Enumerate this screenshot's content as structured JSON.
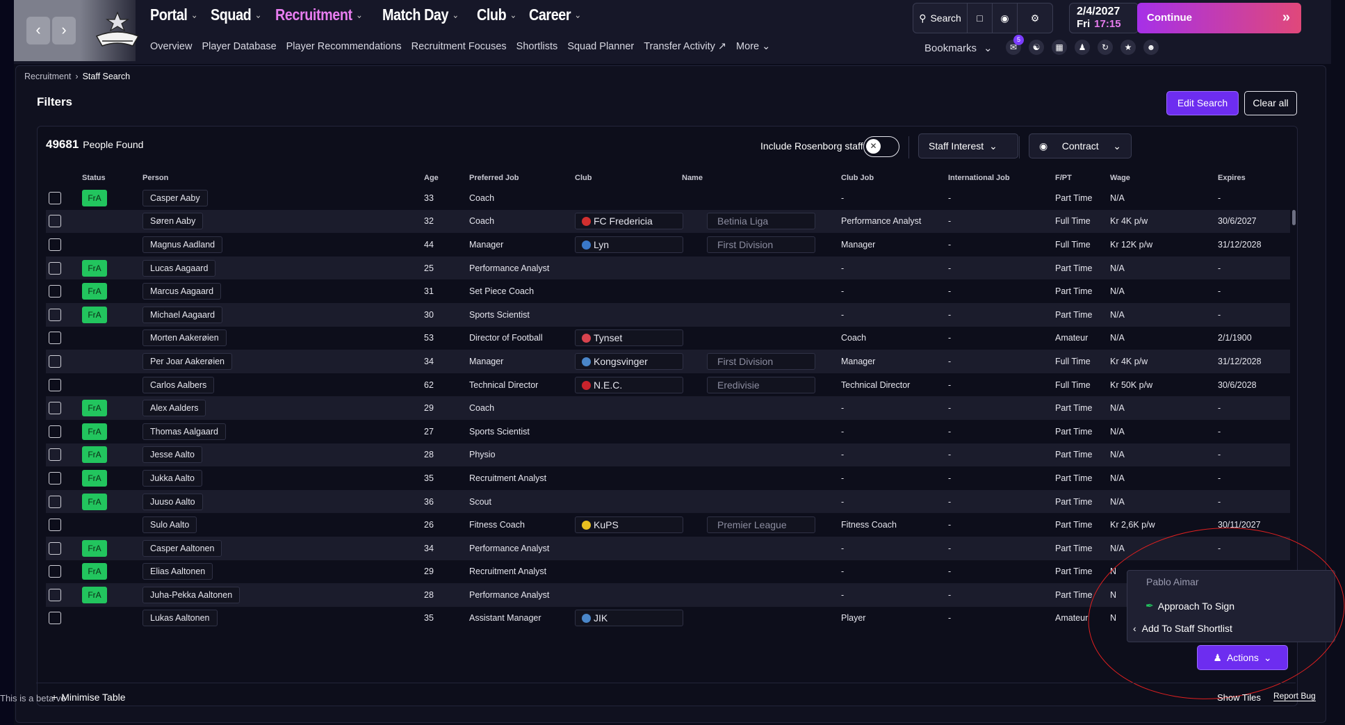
{
  "nav": {
    "main": [
      {
        "label": "Portal",
        "active": false
      },
      {
        "label": "Squad",
        "active": false
      },
      {
        "label": "Recruitment",
        "active": true
      },
      {
        "label": "Match Day",
        "active": false
      },
      {
        "label": "Club",
        "active": false
      },
      {
        "label": "Career",
        "active": false
      }
    ],
    "sub": [
      "Overview",
      "Player Database",
      "Player Recommendations",
      "Recruitment Focuses",
      "Shortlists",
      "Squad Planner",
      "Transfer Activity",
      "More"
    ],
    "search_label": "Search",
    "date": "2/4/2027",
    "day": "Fri",
    "time": "17:15",
    "continue_label": "Continue",
    "bookmarks_label": "Bookmarks",
    "inbox_badge": "5"
  },
  "breadcrumb": [
    "Recruitment",
    "Staff Search"
  ],
  "filters": {
    "title": "Filters",
    "edit_label": "Edit Search",
    "clear_label": "Clear all"
  },
  "table": {
    "count": "49681",
    "count_label": "People Found",
    "include_label": "Include Rosenborg staff",
    "staff_interest_label": "Staff Interest",
    "contract_label": "Contract",
    "columns": [
      "Status",
      "Person",
      "Age",
      "Preferred Job",
      "Club",
      "Name",
      "Club Job",
      "International Job",
      "F/PT",
      "Wage",
      "Expires"
    ],
    "rows": [
      {
        "status": "FrA",
        "person": "Casper Aaby",
        "age": "33",
        "job": "Coach",
        "club": "",
        "league": "",
        "club_job": "-",
        "intl": "-",
        "fpt": "Part Time",
        "wage": "N/A",
        "expires": "-"
      },
      {
        "status": "",
        "person": "Søren Aaby",
        "age": "32",
        "job": "Coach",
        "club": "FC Fredericia",
        "club_color": "#d12f2f",
        "league": "Betinia Liga",
        "club_job": "Performance Analyst",
        "intl": "-",
        "fpt": "Full Time",
        "wage": "Kr 4K p/w",
        "expires": "30/6/2027"
      },
      {
        "status": "",
        "person": "Magnus Aadland",
        "age": "44",
        "job": "Manager",
        "club": "Lyn",
        "club_color": "#3a78c8",
        "league": "First Division",
        "club_job": "Manager",
        "intl": "-",
        "fpt": "Full Time",
        "wage": "Kr 12K p/w",
        "expires": "31/12/2028"
      },
      {
        "status": "FrA",
        "person": "Lucas Aagaard",
        "age": "25",
        "job": "Performance Analyst",
        "club": "",
        "league": "",
        "club_job": "-",
        "intl": "-",
        "fpt": "Part Time",
        "wage": "N/A",
        "expires": "-"
      },
      {
        "status": "FrA",
        "person": "Marcus Aagaard",
        "age": "31",
        "job": "Set Piece Coach",
        "club": "",
        "league": "",
        "club_job": "-",
        "intl": "-",
        "fpt": "Part Time",
        "wage": "N/A",
        "expires": "-"
      },
      {
        "status": "FrA",
        "person": "Michael Aagaard",
        "age": "30",
        "job": "Sports Scientist",
        "club": "",
        "league": "",
        "club_job": "-",
        "intl": "-",
        "fpt": "Part Time",
        "wage": "N/A",
        "expires": "-"
      },
      {
        "status": "",
        "person": "Morten Aakerøien",
        "age": "53",
        "job": "Director of Football",
        "club": "Tynset",
        "club_color": "#d8434e",
        "league": "",
        "club_job": "Coach",
        "intl": "-",
        "fpt": "Amateur",
        "wage": "N/A",
        "expires": "2/1/1900"
      },
      {
        "status": "",
        "person": "Per Joar Aakerøien",
        "age": "34",
        "job": "Manager",
        "club": "Kongsvinger",
        "club_color": "#4a86c9",
        "league": "First Division",
        "club_job": "Manager",
        "intl": "-",
        "fpt": "Full Time",
        "wage": "Kr 4K p/w",
        "expires": "31/12/2028"
      },
      {
        "status": "",
        "person": "Carlos Aalbers",
        "age": "62",
        "job": "Technical Director",
        "club": "N.E.C.",
        "club_color": "#c8232c",
        "league": "Eredivisie",
        "club_job": "Technical Director",
        "intl": "-",
        "fpt": "Full Time",
        "wage": "Kr 50K p/w",
        "expires": "30/6/2028"
      },
      {
        "status": "FrA",
        "person": "Alex Aalders",
        "age": "29",
        "job": "Coach",
        "club": "",
        "league": "",
        "club_job": "-",
        "intl": "-",
        "fpt": "Part Time",
        "wage": "N/A",
        "expires": "-"
      },
      {
        "status": "FrA",
        "person": "Thomas Aalgaard",
        "age": "27",
        "job": "Sports Scientist",
        "club": "",
        "league": "",
        "club_job": "-",
        "intl": "-",
        "fpt": "Part Time",
        "wage": "N/A",
        "expires": "-"
      },
      {
        "status": "FrA",
        "person": "Jesse Aalto",
        "age": "28",
        "job": "Physio",
        "club": "",
        "league": "",
        "club_job": "-",
        "intl": "-",
        "fpt": "Part Time",
        "wage": "N/A",
        "expires": "-"
      },
      {
        "status": "FrA",
        "person": "Jukka Aalto",
        "age": "35",
        "job": "Recruitment Analyst",
        "club": "",
        "league": "",
        "club_job": "-",
        "intl": "-",
        "fpt": "Part Time",
        "wage": "N/A",
        "expires": "-"
      },
      {
        "status": "FrA",
        "person": "Juuso Aalto",
        "age": "36",
        "job": "Scout",
        "club": "",
        "league": "",
        "club_job": "-",
        "intl": "-",
        "fpt": "Part Time",
        "wage": "N/A",
        "expires": "-"
      },
      {
        "status": "",
        "person": "Sulo Aalto",
        "age": "26",
        "job": "Fitness Coach",
        "club": "KuPS",
        "club_color": "#e8c020",
        "league": "Premier League",
        "club_job": "Fitness Coach",
        "intl": "-",
        "fpt": "Part Time",
        "wage": "Kr 2,6K p/w",
        "expires": "30/11/2027"
      },
      {
        "status": "FrA",
        "person": "Casper Aaltonen",
        "age": "34",
        "job": "Performance Analyst",
        "club": "",
        "league": "",
        "club_job": "-",
        "intl": "-",
        "fpt": "Part Time",
        "wage": "N/A",
        "expires": "-"
      },
      {
        "status": "FrA",
        "person": "Elias Aaltonen",
        "age": "29",
        "job": "Recruitment Analyst",
        "club": "",
        "league": "",
        "club_job": "-",
        "intl": "-",
        "fpt": "Part Time",
        "wage": "N",
        "expires": ""
      },
      {
        "status": "FrA",
        "person": "Juha-Pekka Aaltonen",
        "age": "28",
        "job": "Performance Analyst",
        "club": "",
        "league": "",
        "club_job": "-",
        "intl": "-",
        "fpt": "Part Time",
        "wage": "N",
        "expires": ""
      },
      {
        "status": "",
        "person": "Lukas Aaltonen",
        "age": "35",
        "job": "Assistant Manager",
        "club": "JIK",
        "club_color": "#4a86c9",
        "league": "",
        "club_job": "Player",
        "intl": "-",
        "fpt": "Amateur",
        "wage": "N",
        "expires": ""
      }
    ]
  },
  "context_menu": {
    "header": "Pablo Aimar",
    "approach": "Approach To Sign",
    "shortlist": "Add To Staff Shortlist"
  },
  "actions_label": "Actions",
  "footer": {
    "minimise": "Minimise Table",
    "beta": "This is a beta ve",
    "show_tiles": "Show Tiles",
    "report_bug": "Report Bug"
  },
  "colors": {
    "accent": "#6d2df0",
    "active_nav": "#e87df0",
    "status_green": "#22c55e",
    "annotation_red": "#e02020"
  }
}
